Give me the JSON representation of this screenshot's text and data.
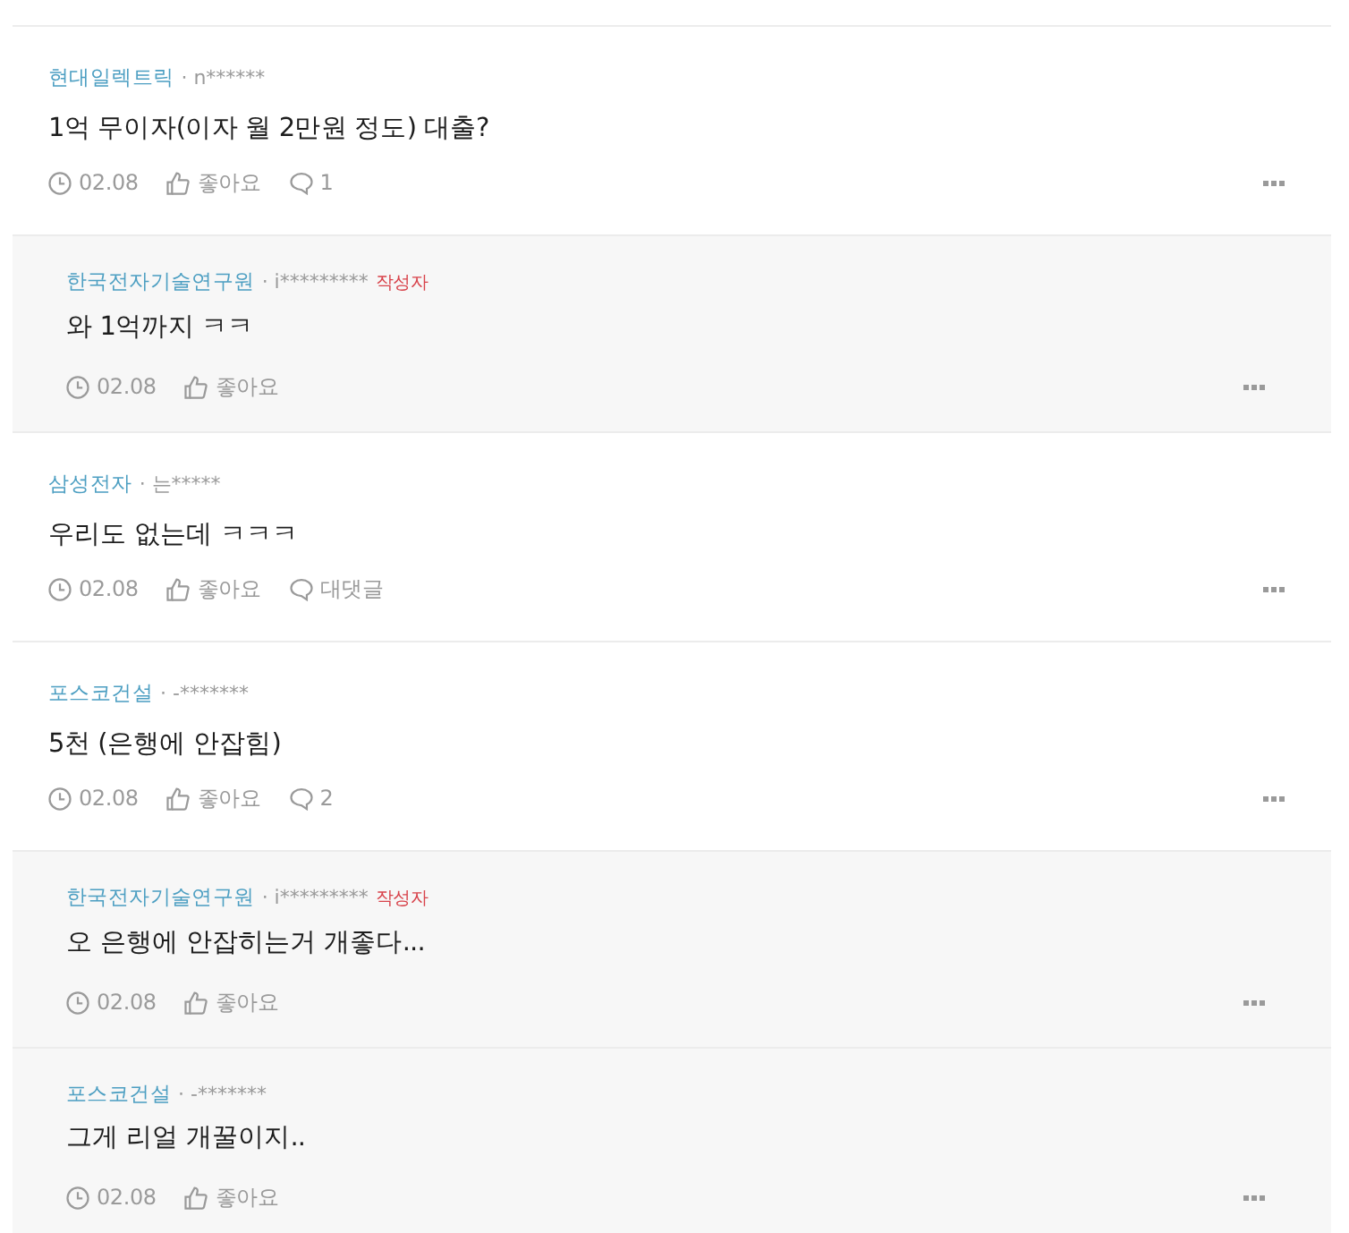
{
  "comments": [
    {
      "kind": "post",
      "company": "현대일렉트릭",
      "user": "· n******",
      "text": "1억 무이자(이자 월 2만원 정도) 대출?",
      "date": "02.08",
      "like": "좋아요",
      "reply": "1"
    },
    {
      "kind": "reply",
      "company": "한국전자기술연구원",
      "user": "· i*********",
      "badge": "작성자",
      "text": "와 1억까지 ㅋㅋ",
      "date": "02.08",
      "like": "좋아요"
    },
    {
      "kind": "post",
      "company": "삼성전자",
      "user": "· 는*****",
      "text": "우리도 없는데 ㅋㅋㅋ",
      "date": "02.08",
      "like": "좋아요",
      "reply": "대댓글"
    },
    {
      "kind": "post",
      "company": "포스코건설",
      "user": "· -*******",
      "text": "5천 (은행에 안잡힘)",
      "date": "02.08",
      "like": "좋아요",
      "reply": "2"
    },
    {
      "kind": "reply",
      "company": "한국전자기술연구원",
      "user": "· i*********",
      "badge": "작성자",
      "text": "오 은행에 안잡히는거 개좋다...",
      "date": "02.08",
      "like": "좋아요"
    },
    {
      "kind": "reply",
      "company": "포스코건설",
      "user": "· -*******",
      "text": "그게 리얼 개꿀이지..",
      "date": "02.08",
      "like": "좋아요"
    }
  ]
}
